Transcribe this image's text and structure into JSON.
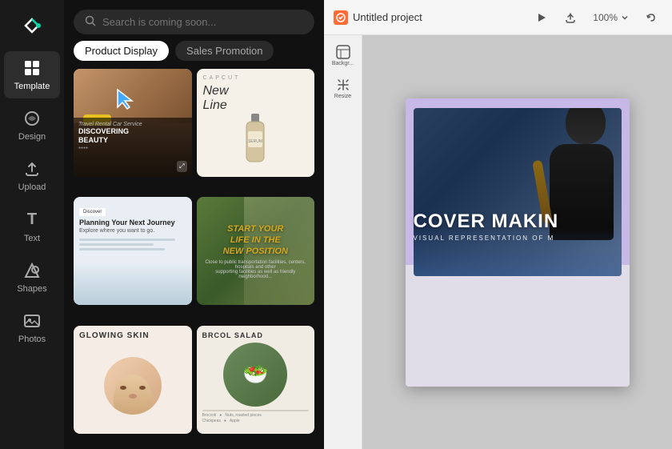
{
  "app": {
    "logo_label": "CapCut",
    "cursor_icon": "▶"
  },
  "sidebar": {
    "items": [
      {
        "id": "template",
        "label": "Template",
        "icon": "⊞",
        "active": true
      },
      {
        "id": "design",
        "label": "Design",
        "icon": "✦",
        "active": false
      },
      {
        "id": "upload",
        "label": "Upload",
        "icon": "⬆",
        "active": false
      },
      {
        "id": "text",
        "label": "Text",
        "icon": "T",
        "active": false
      },
      {
        "id": "shapes",
        "label": "Shapes",
        "icon": "♡",
        "active": false
      },
      {
        "id": "photos",
        "label": "Photos",
        "icon": "🖼",
        "active": false
      }
    ]
  },
  "middle_panel": {
    "search": {
      "placeholder": "Search is coming soon..."
    },
    "filters": [
      {
        "id": "product-display",
        "label": "Product Display",
        "active": true
      },
      {
        "id": "sales-promotion",
        "label": "Sales Promotion",
        "active": false
      }
    ],
    "templates": [
      {
        "id": "card-1",
        "title": "DiScoveRINg BEAUTY",
        "subtitle": "Travel Rental Car Service",
        "badge": ""
      },
      {
        "id": "card-2",
        "title": "New Line",
        "subtitle": "CAPCUT",
        "badge": ""
      },
      {
        "id": "card-3",
        "title": "Planning Your Next Journey",
        "subtitle": "Explore where you want to go.",
        "badge": "Discover"
      },
      {
        "id": "card-4",
        "title": "START YOUR LIFE IN THE NEW POSITION",
        "subtitle": "",
        "badge": ""
      },
      {
        "id": "card-5",
        "title": "GLOWING SKIN",
        "subtitle": "",
        "badge": ""
      },
      {
        "id": "card-6",
        "title": "BRCOL SALAD",
        "subtitle": "",
        "badge": ""
      }
    ]
  },
  "canvas_panel": {
    "project_title": "Untitled project",
    "zoom_level": "100%",
    "main_text": "COVER MAKIN",
    "sub_text": "VISUAL REPRESENTATION OF M",
    "tools": [
      {
        "id": "background",
        "label": "Backgr...",
        "icon": "▣"
      },
      {
        "id": "resize",
        "label": "Resize",
        "icon": "⇔"
      }
    ],
    "topbar_buttons": [
      {
        "id": "play",
        "icon": "▷"
      },
      {
        "id": "export",
        "icon": "⬆"
      },
      {
        "id": "zoom",
        "label": "100%"
      },
      {
        "id": "undo",
        "icon": "↩"
      }
    ]
  }
}
